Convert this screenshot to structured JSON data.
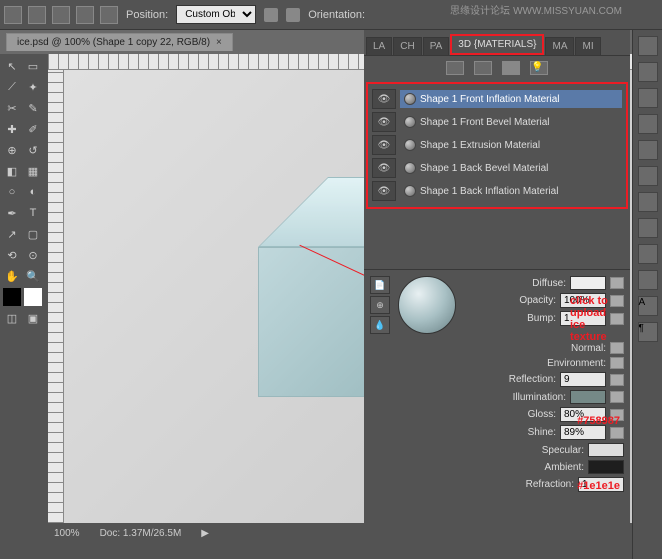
{
  "watermark_left": "思缘设计论坛",
  "watermark_right": "WWW.MISSYUAN.COM",
  "toolbar": {
    "position_label": "Position:",
    "position_value": "Custom Ob...",
    "orientation_label": "Orientation:"
  },
  "file_tab": {
    "title": "ice.psd @ 100% (Shape 1 copy 22, RGB/8)"
  },
  "status": {
    "zoom": "100%",
    "doc": "Doc: 1.37M/26.5M"
  },
  "panel_tabs": [
    "LA",
    "CH",
    "PA",
    "3D {MATERIALS}",
    "MA",
    "MI"
  ],
  "materials": [
    {
      "name": "Shape 1 Front Inflation Material",
      "selected": true
    },
    {
      "name": "Shape 1 Front Bevel Material",
      "selected": false
    },
    {
      "name": "Shape 1 Extrusion Material",
      "selected": false
    },
    {
      "name": "Shape 1 Back Bevel Material",
      "selected": false
    },
    {
      "name": "Shape 1 Back Inflation Material",
      "selected": false
    }
  ],
  "props": {
    "diffuse_label": "Diffuse:",
    "opacity_label": "Opacity:",
    "opacity_value": "100%",
    "bump_label": "Bump:",
    "bump_value": "1",
    "normal_label": "Normal:",
    "environment_label": "Environment:",
    "reflection_label": "Reflection:",
    "reflection_value": "9",
    "illumination_label": "Illumination:",
    "illumination_color": "#758987",
    "gloss_label": "Gloss:",
    "gloss_value": "80%",
    "shine_label": "Shine:",
    "shine_value": "89%",
    "specular_label": "Specular:",
    "ambient_label": "Ambient:",
    "ambient_color": "#1e1e1e",
    "refraction_label": "Refraction:",
    "refraction_value": "1"
  },
  "annotations": {
    "upload": "click to upload ice texture",
    "illum_hex": "#758987",
    "ambient_hex": "#1e1e1e"
  }
}
